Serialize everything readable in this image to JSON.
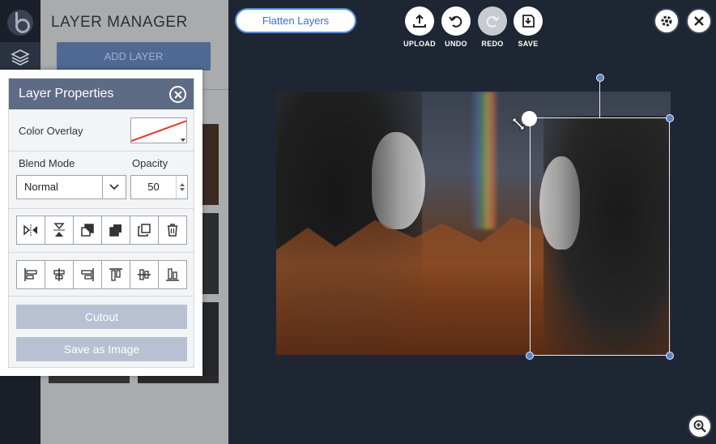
{
  "manager": {
    "title": "LAYER MANAGER",
    "add_layer_label": "ADD LAYER"
  },
  "toolbar": {
    "flatten_label": "Flatten Layers",
    "upload_label": "UPLOAD",
    "undo_label": "UNDO",
    "redo_label": "REDO",
    "save_label": "SAVE"
  },
  "properties": {
    "title": "Layer Properties",
    "color_overlay_label": "Color Overlay",
    "blend_mode_label": "Blend Mode",
    "blend_mode_value": "Normal",
    "opacity_label": "Opacity",
    "opacity_value": "50",
    "cutout_label": "Cutout",
    "save_image_label": "Save as Image"
  },
  "colors": {
    "panel_header": "#5d6b85",
    "accent": "#5a86c8",
    "workspace": "#1f2633",
    "overlay_line": "#e2372b"
  }
}
